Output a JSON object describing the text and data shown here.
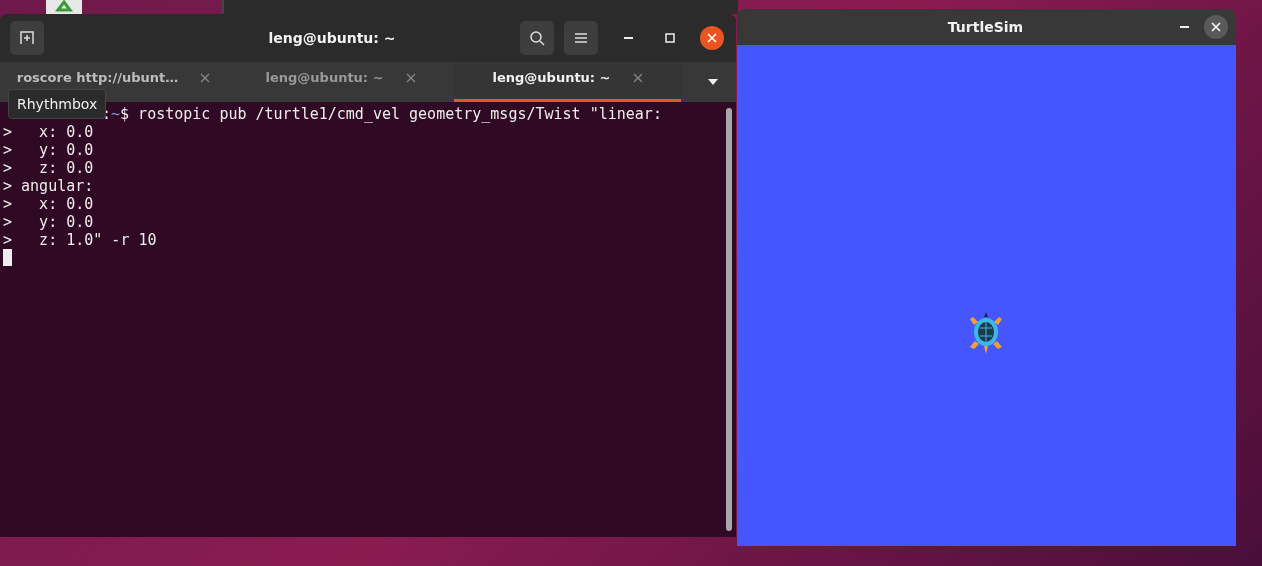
{
  "terminal": {
    "title": "leng@ubuntu: ~",
    "tabs": [
      {
        "label": "roscore http://ubunt…",
        "selected": false
      },
      {
        "label": "leng@ubuntu: ~",
        "selected": false
      },
      {
        "label": "leng@ubuntu: ~",
        "selected": true
      }
    ],
    "tooltip": "Rhythmbox",
    "lines": [
      {
        "kind": "prompt",
        "separator": ":",
        "path": "~",
        "text": "$ rostopic pub /turtle1/cmd_vel geometry_msgs/Twist \"linear:"
      },
      {
        "kind": "output",
        "text": ">   x: 0.0"
      },
      {
        "kind": "output",
        "text": ">   y: 0.0"
      },
      {
        "kind": "output",
        "text": ">   z: 0.0"
      },
      {
        "kind": "output",
        "text": "> angular:"
      },
      {
        "kind": "output",
        "text": ">   x: 0.0"
      },
      {
        "kind": "output",
        "text": ">   y: 0.0"
      },
      {
        "kind": "output",
        "text": ">   z: 1.0\" -r 10"
      },
      {
        "kind": "cursor"
      }
    ]
  },
  "turtlesim": {
    "title": "TurtleSim"
  }
}
